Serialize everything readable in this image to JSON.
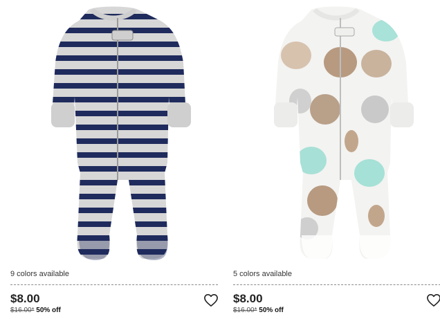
{
  "products": [
    {
      "colors_available": "9 colors available",
      "price": "$8.00",
      "original_price": "$16.00*",
      "discount": "50% off",
      "image_desc": "Striped sleep and play",
      "palette": {
        "stripe": "#1e2a5e",
        "base": "#d8d8d8"
      }
    },
    {
      "colors_available": "5 colors available",
      "price": "$8.00",
      "original_price": "$16.00*",
      "discount": "50% off",
      "image_desc": "Dog print sleep and play",
      "palette": {
        "base": "#f2f2f0",
        "brown": "#b99b82",
        "mint": "#9fe0d6",
        "grey": "#c9c9c9"
      }
    }
  ],
  "icons": {
    "favorite": "heart-outline-icon"
  }
}
